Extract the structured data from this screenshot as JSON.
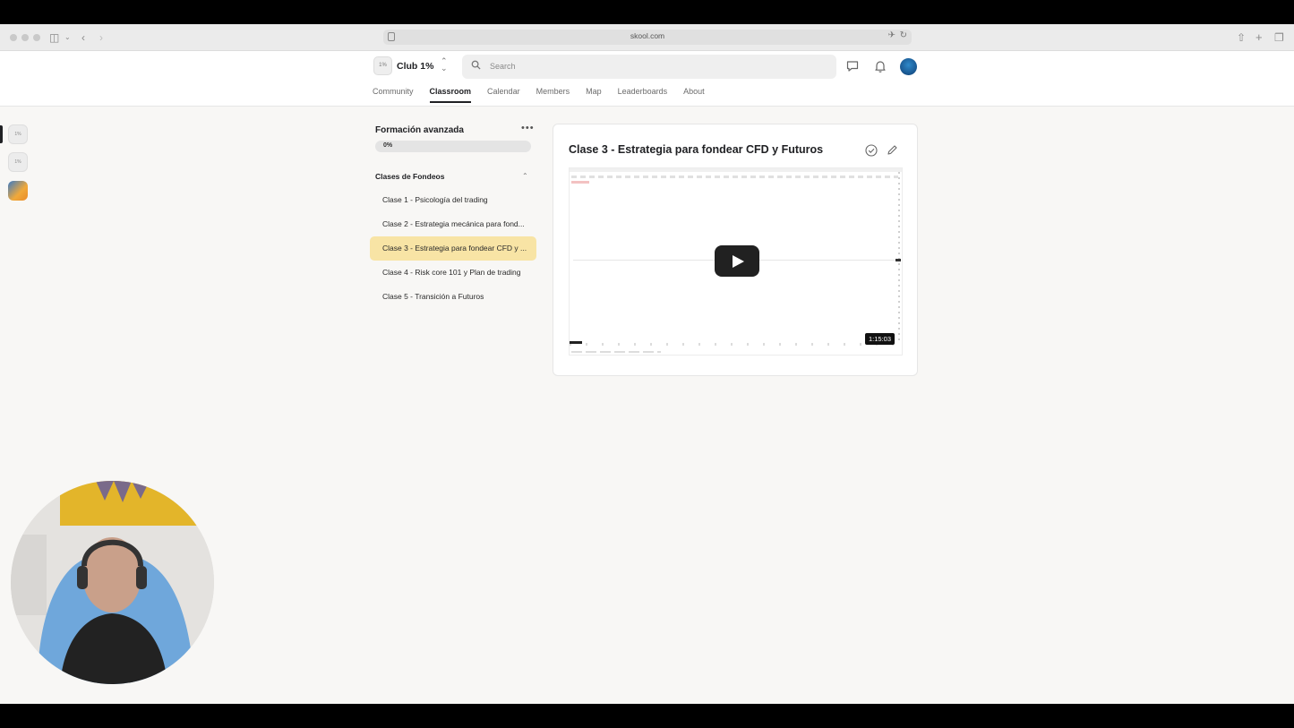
{
  "browser": {
    "url": "skool.com"
  },
  "header": {
    "club_logo_text": "1%",
    "club_name": "Club 1%",
    "search_placeholder": "Search"
  },
  "tabs": [
    {
      "label": "Community"
    },
    {
      "label": "Classroom",
      "active": true
    },
    {
      "label": "Calendar"
    },
    {
      "label": "Members"
    },
    {
      "label": "Map"
    },
    {
      "label": "Leaderboards"
    },
    {
      "label": "About"
    }
  ],
  "rail": {
    "items": [
      {
        "text": "1%"
      },
      {
        "text": "1%"
      }
    ]
  },
  "course": {
    "title": "Formación avanzada",
    "progress_percent": 0,
    "progress_label": "0%",
    "section_title": "Clases de Fondeos",
    "lessons": [
      {
        "label": "Clase 1 - Psicología del trading"
      },
      {
        "label": "Clase 2 - Estrategia mecánica para fond..."
      },
      {
        "label": "Clase 3 - Estrategia para fondear CFD y ...",
        "active": true
      },
      {
        "label": "Clase 4 - Risk core 101 y Plan de trading"
      },
      {
        "label": "Clase 5 - Transición a Futuros"
      }
    ]
  },
  "content": {
    "title": "Clase 3 - Estrategia para fondear CFD y Futuros",
    "video_duration": "1:15:03"
  },
  "colors": {
    "active_lesson_bg": "#f8e4a5",
    "avatar": "#1b5c97"
  }
}
